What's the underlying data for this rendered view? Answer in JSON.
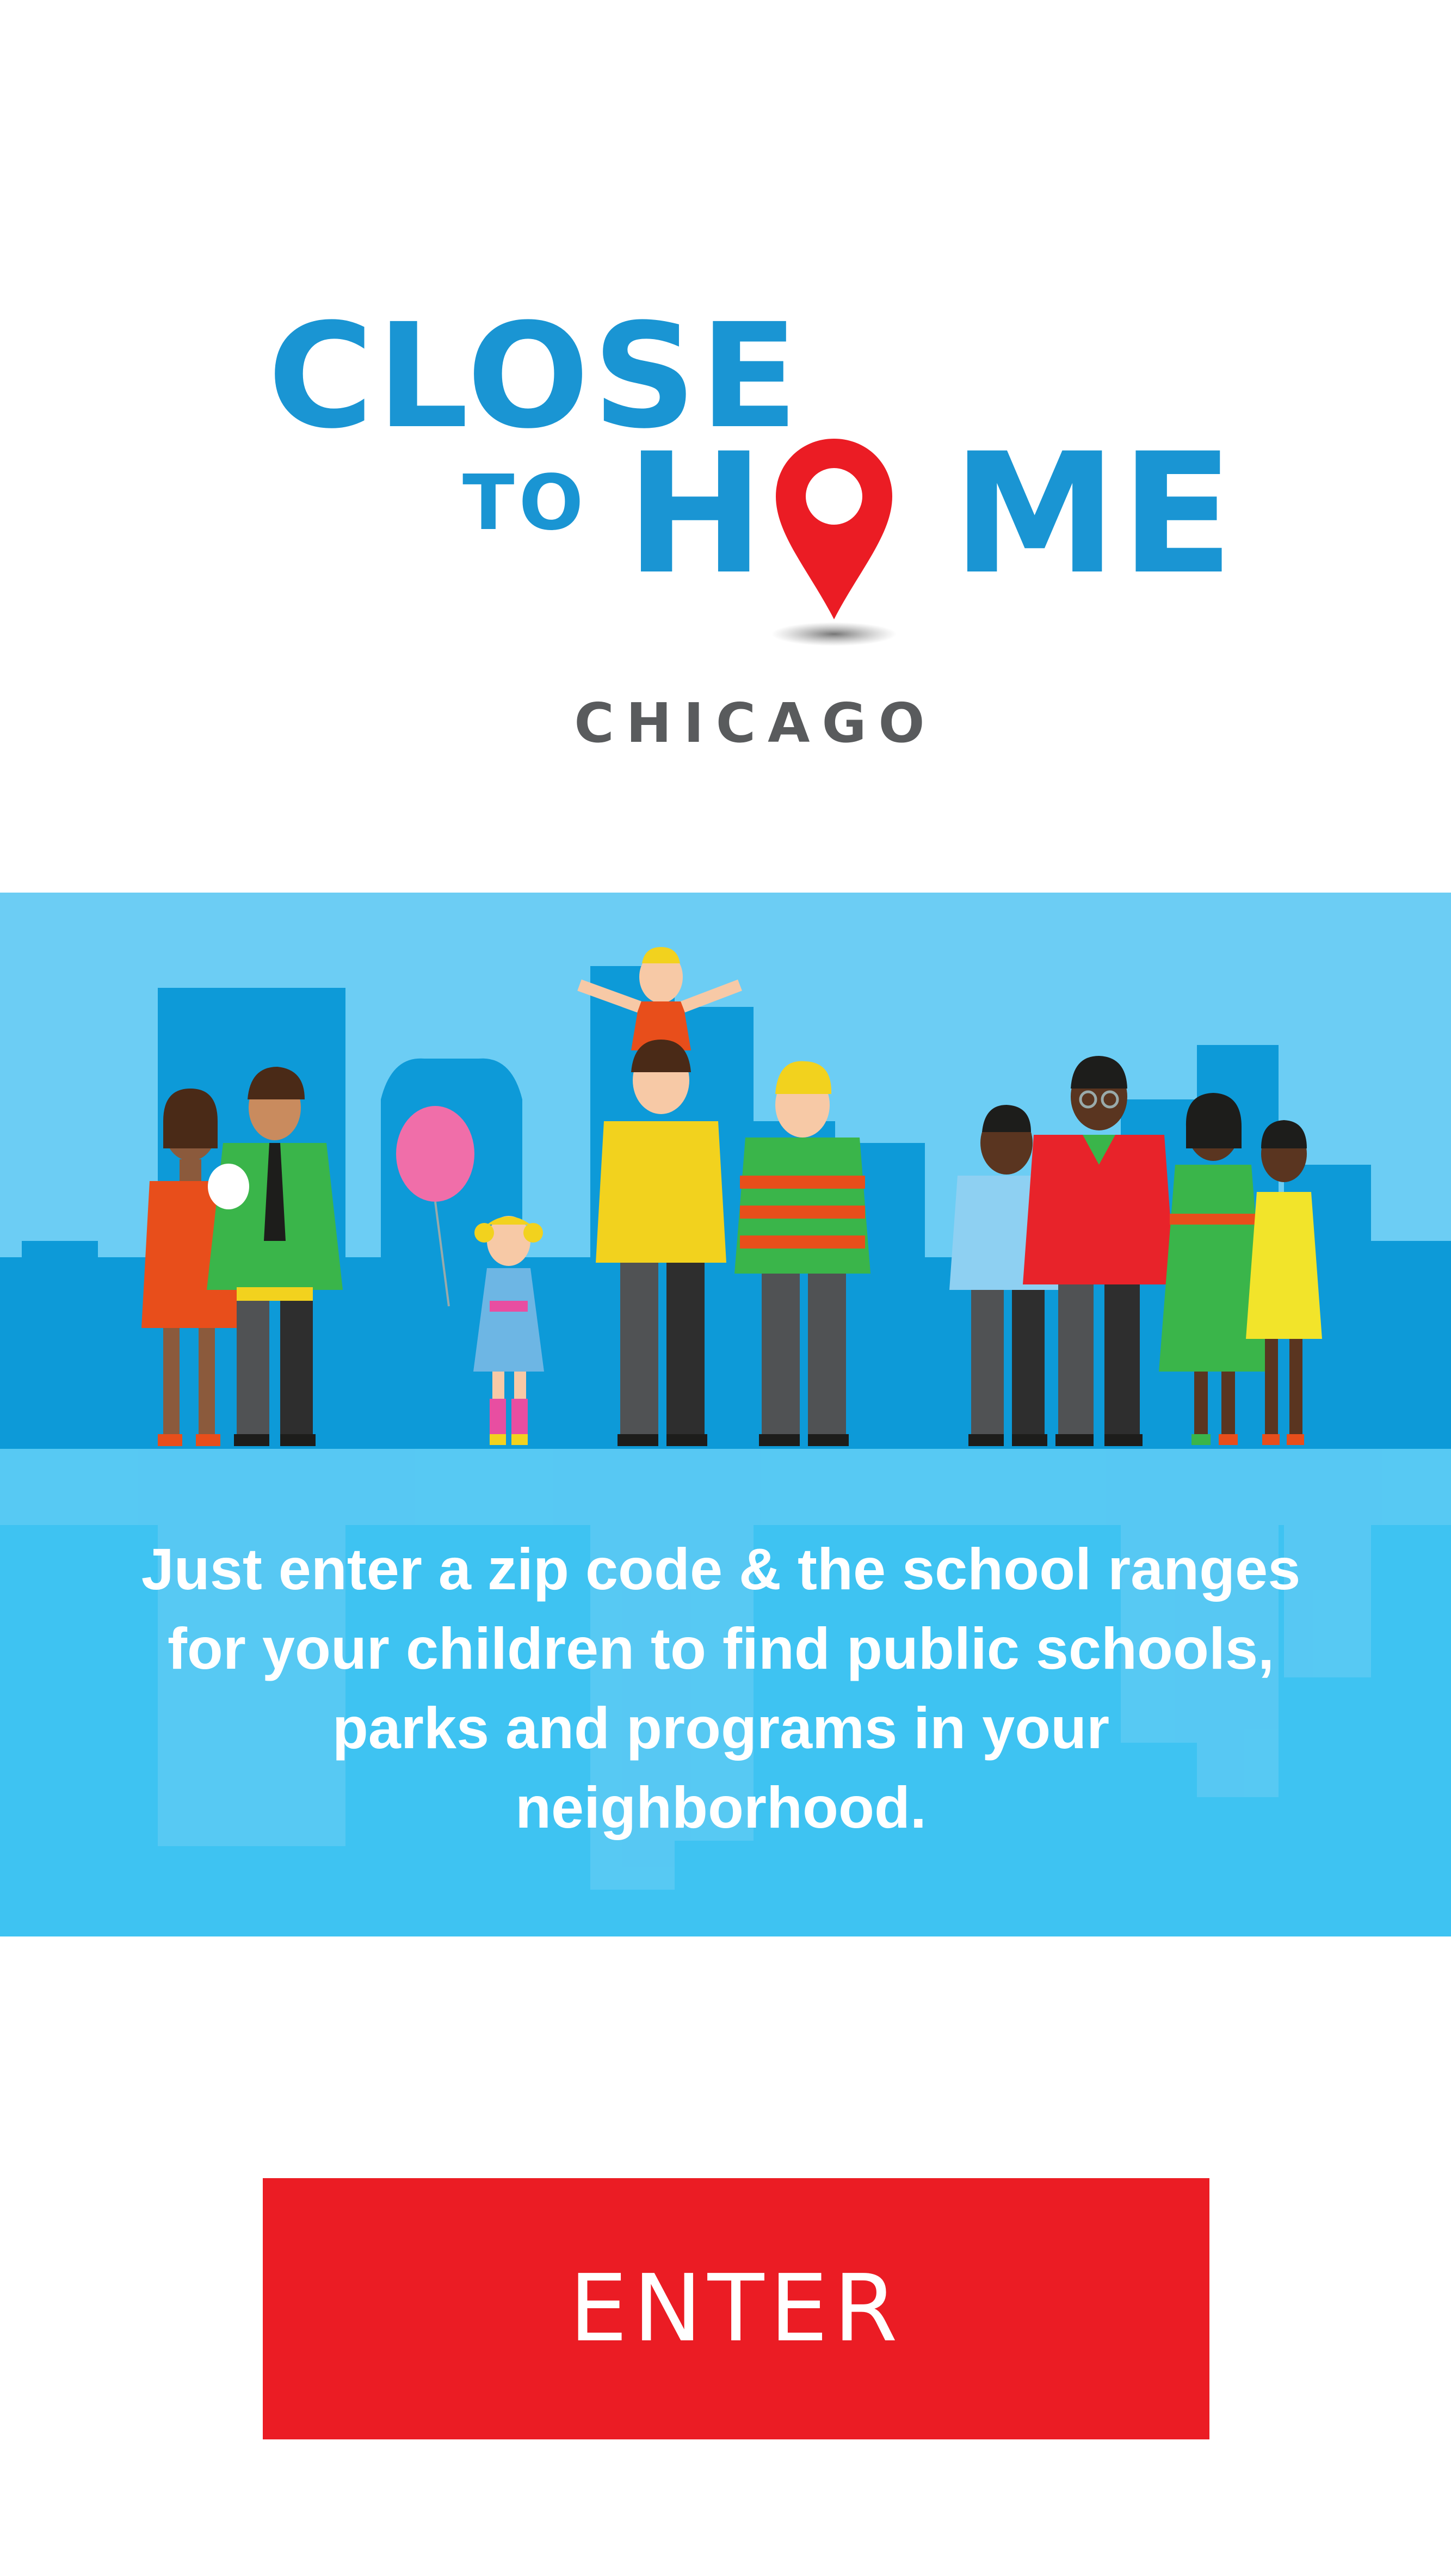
{
  "logo": {
    "line1": "CLOSE",
    "line2_small": "TO",
    "line2_h": "H",
    "line2_rest": "ME",
    "city": "CHICAGO",
    "pin_icon": "map-pin-icon",
    "brand_blue": "#1a95d3",
    "pin_red": "#eb1c24",
    "city_gray": "#595b5d"
  },
  "hero": {
    "description": "Just enter a zip code & the school ranges for your children to find public schools, parks and programs in your neighborhood.",
    "sky_color": "#6ccdf4",
    "skyline_color": "#0d9ad8",
    "ground_color": "#3ec3f2"
  },
  "cta": {
    "label": "ENTER",
    "color": "#eb1c24"
  }
}
